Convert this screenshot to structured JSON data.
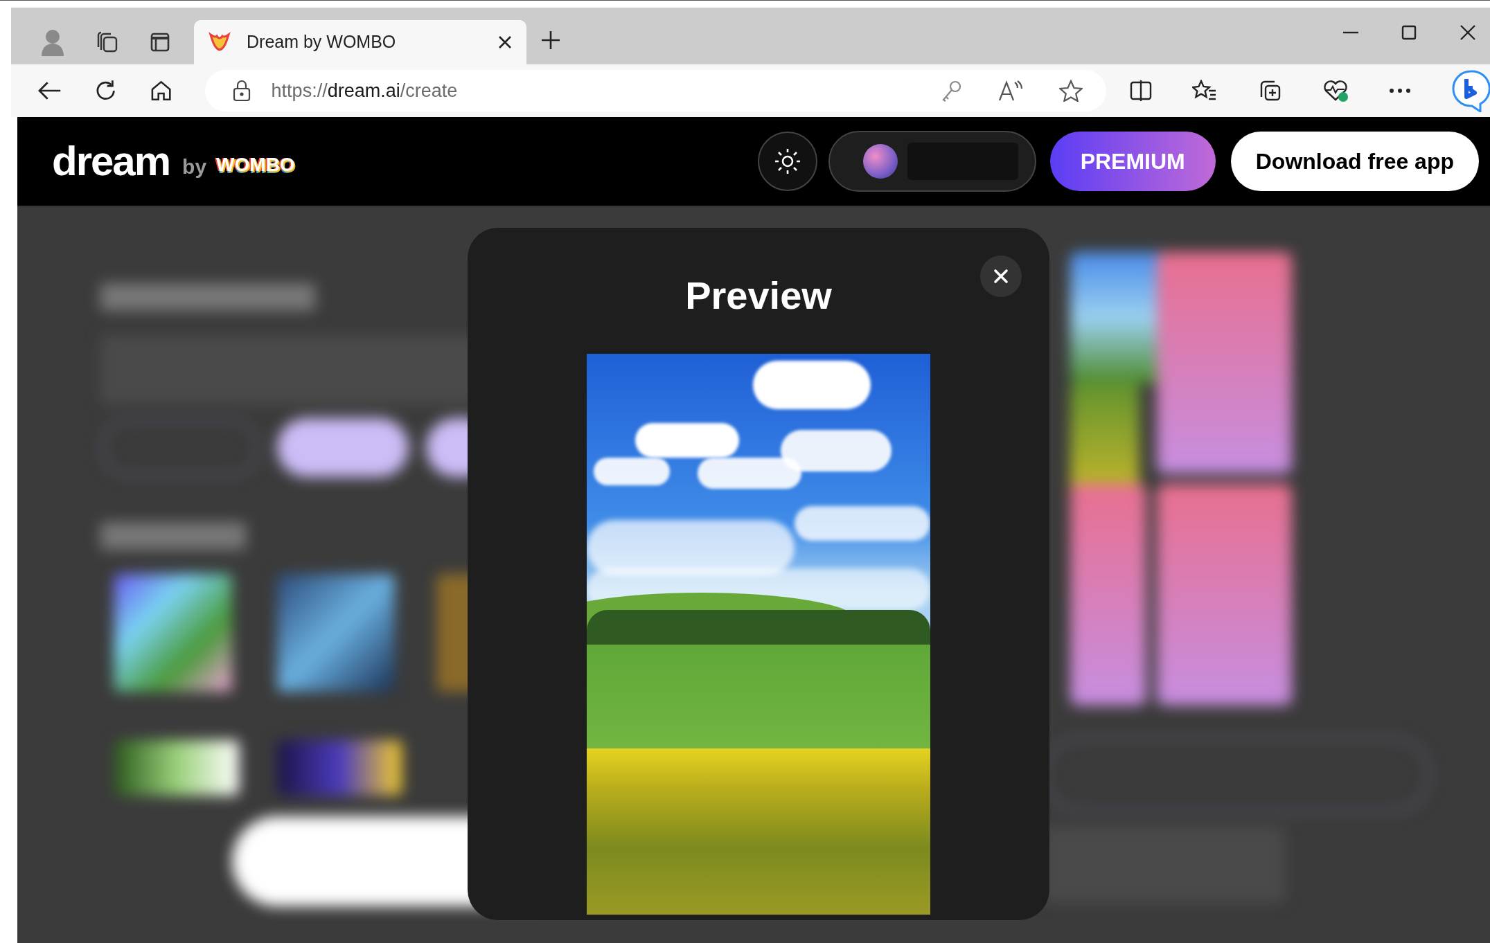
{
  "browser": {
    "tab": {
      "title": "Dream by WOMBO",
      "selected": true
    },
    "url": {
      "scheme": "https://",
      "domain": "dream.ai",
      "path": "/create"
    }
  },
  "header": {
    "logo": "dream",
    "by": "by",
    "brand": "WOMBO",
    "buttons": [
      {
        "label": "PREMIUM",
        "kind": "premium"
      },
      {
        "label": "Download free app",
        "kind": "light"
      }
    ]
  },
  "modal": {
    "title": "Preview"
  }
}
